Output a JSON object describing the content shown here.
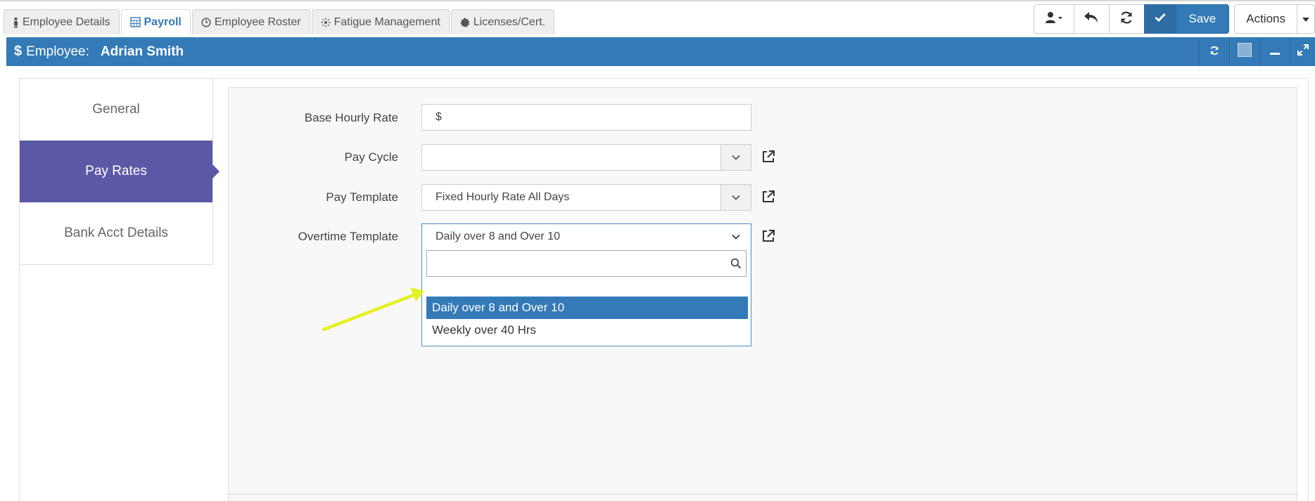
{
  "tabs": [
    {
      "label": "Employee Details",
      "icon": "person-icon",
      "active": false
    },
    {
      "label": "Payroll",
      "icon": "calculator-icon",
      "active": true
    },
    {
      "label": "Employee Roster",
      "icon": "clock-icon",
      "active": false
    },
    {
      "label": "Fatigue Management",
      "icon": "sun-icon",
      "active": false
    },
    {
      "label": "Licenses/Cert.",
      "icon": "badge-icon",
      "active": false
    }
  ],
  "toolbar": {
    "save_label": "Save",
    "actions_label": "Actions"
  },
  "header": {
    "prefix": "Employee:",
    "employee_name": "Adrian Smith"
  },
  "sidebar": {
    "items": [
      {
        "label": "General",
        "active": false
      },
      {
        "label": "Pay Rates",
        "active": true
      },
      {
        "label": "Bank Acct Details",
        "active": false
      }
    ]
  },
  "form": {
    "base_hourly_rate": {
      "label": "Base Hourly Rate",
      "value": "$"
    },
    "pay_cycle": {
      "label": "Pay Cycle",
      "value": ""
    },
    "pay_template": {
      "label": "Pay Template",
      "value": "Fixed Hourly Rate All Days"
    },
    "overtime_template": {
      "label": "Overtime Template",
      "value": "Daily over 8 and Over 10"
    }
  },
  "dropdown": {
    "search_placeholder": "",
    "options": [
      {
        "label": "Daily over 8 and Over 10",
        "selected": true
      },
      {
        "label": "Weekly over 40 Hrs",
        "selected": false
      }
    ]
  },
  "colors": {
    "primary": "#337ab7",
    "sidebar_active": "#5b59a6",
    "annotation_arrow": "#e4f022"
  }
}
